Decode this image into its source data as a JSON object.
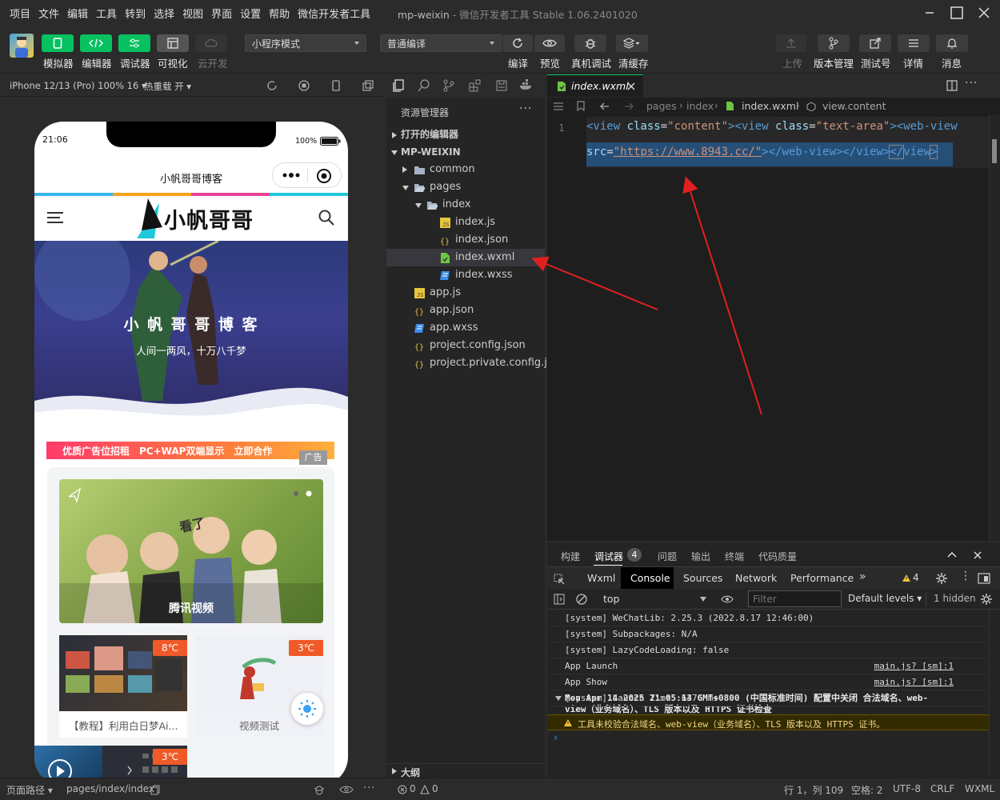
{
  "menu": [
    "项目",
    "文件",
    "编辑",
    "工具",
    "转到",
    "选择",
    "视图",
    "界面",
    "设置",
    "帮助",
    "微信开发者工具"
  ],
  "window_title": {
    "app": "mp-weixin",
    "sub": " - 微信开发者工具 Stable 1.06.2401020"
  },
  "toolbar": {
    "left": [
      "模拟器",
      "编辑器",
      "调试器",
      "可视化",
      "云开发"
    ],
    "mode_select": "小程序模式",
    "compile_select": "普通编译",
    "middle": [
      "编译",
      "预览",
      "真机调试",
      "清缓存"
    ],
    "right": [
      "上传",
      "版本管理",
      "测试号",
      "详情",
      "消息"
    ]
  },
  "simbar": {
    "device": "iPhone 12/13 (Pro) 100% 16 ▾",
    "hot_reload": "热重载 开 ▾"
  },
  "phone": {
    "time": "21:06",
    "battery": "100%",
    "nav_title": "小帆哥哥博客",
    "logo_text": "小帆哥哥",
    "hero_title": "小 帆 哥 哥 博 客",
    "hero_sub": "人间一两风，十万八千梦",
    "ad_text": "优质广告位招租　PC+WAP双端显示　立即合作",
    "ad_badge": "广告",
    "card_caption": "腾讯视频",
    "card_small_tag": "看了",
    "item1_temp": "8℃",
    "item1_title": "【教程】利用白日梦Ai...",
    "item2_temp": "3℃",
    "item2_title": "视频测试",
    "item3_temp": "3℃"
  },
  "explorer": {
    "title": "资源管理器",
    "open_editors": "打开的编辑器",
    "project": "MP-WEIXIN",
    "files": [
      {
        "name": "common",
        "type": "folder",
        "depth": 1
      },
      {
        "name": "pages",
        "type": "folder-open",
        "depth": 1
      },
      {
        "name": "index",
        "type": "folder-open",
        "depth": 2
      },
      {
        "name": "index.js",
        "type": "js",
        "depth": 3
      },
      {
        "name": "index.json",
        "type": "json",
        "depth": 3
      },
      {
        "name": "index.wxml",
        "type": "wxml",
        "depth": 3
      },
      {
        "name": "index.wxss",
        "type": "wxss",
        "depth": 3
      },
      {
        "name": "app.js",
        "type": "js",
        "depth": 1
      },
      {
        "name": "app.json",
        "type": "json",
        "depth": 1
      },
      {
        "name": "app.wxss",
        "type": "wxss",
        "depth": 1
      },
      {
        "name": "project.config.json",
        "type": "json",
        "depth": 1
      },
      {
        "name": "project.private.config.js...",
        "type": "json",
        "depth": 1
      }
    ],
    "outline": "大纲"
  },
  "editor": {
    "tab": "index.wxml",
    "breadcrumb": [
      "pages",
      "index",
      "index.wxml",
      "view.content"
    ],
    "line_number": "1",
    "code": {
      "l1_a": "<view ",
      "attr1": "class",
      "eq": "=",
      "v1": "\"content\"",
      "l1_b": "><view ",
      "attr2": "class",
      "v2": "\"text-area\"",
      "l1_c": "><web-view",
      "attr3": "src",
      "v3": "\"https://www.8943.cc/\"",
      "l2_b": "></web-view></view>",
      "l2_c": "</",
      "l2_d": "view",
      "l2_e": ">"
    }
  },
  "panel": {
    "tabs": [
      "构建",
      "调试器",
      "问题",
      "输出",
      "终端",
      "代码质量"
    ],
    "debug_count": "4",
    "devtabs": [
      "Wxml",
      "Console",
      "Sources",
      "Network",
      "Performance"
    ],
    "warn_count": "4",
    "context": "top",
    "filter_placeholder": "Filter",
    "levels": "Default levels ▾",
    "hidden": "1 hidden",
    "console_lines": [
      {
        "text": "[system] WeChatLib: 2.25.3 (2022.8.17 12:46:00)",
        "link": ""
      },
      {
        "text": "[system] Subpackages: N/A",
        "link": ""
      },
      {
        "text": "[system] LazyCodeLoading: false",
        "link": ""
      },
      {
        "text": "App Launch",
        "link": "main.js? [sm]:1"
      },
      {
        "text": "App Show",
        "link": "main.js? [sm]:1"
      },
      {
        "text": "[system] Launch Time: 6476 ms",
        "link": ""
      }
    ],
    "group_line1": "Mon Apr 14 2025 21:05:13 GMT+0800 (中国标准时间) 配置中关闭 合法域名、web-",
    "group_line2": "view（业务域名）、TLS 版本以及 HTTPS 证书检查",
    "warning": "工具未校验合法域名、web-view（业务域名）、TLS 版本以及 HTTPS 证书。"
  },
  "statusbar": {
    "page_path_label": "页面路径 ▾",
    "page_path": "pages/index/index",
    "errors": "0",
    "warnings": "0",
    "position": "行 1，列 109",
    "spaces": "空格: 2",
    "encoding": "UTF-8",
    "eol": "CRLF",
    "lang": "WXML"
  },
  "colors": {
    "accent_green": "#07c160",
    "selection": "#264f78",
    "arrow_red": "#e02020"
  }
}
